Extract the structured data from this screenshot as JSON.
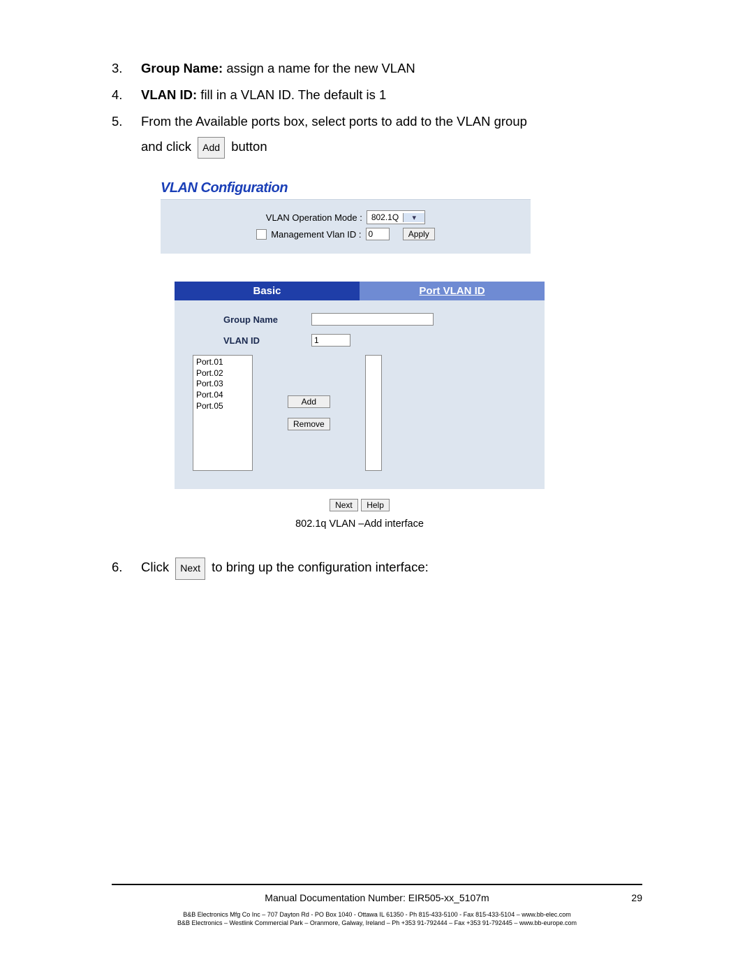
{
  "steps": {
    "s3": {
      "num": "3.",
      "label": "Group Name:",
      "text": " assign a name for the new VLAN"
    },
    "s4": {
      "num": "4.",
      "label": "VLAN ID:",
      "text": " fill in a VLAN ID. The default is 1"
    },
    "s5": {
      "num": "5.",
      "line1": "From the Available ports box, select ports to add to the VLAN group",
      "line2_before": "and click ",
      "btn": "Add",
      "line2_after": " button"
    },
    "s6": {
      "num": "6.",
      "before": "Click ",
      "btn": "Next",
      "after": " to bring up the configuration interface:"
    }
  },
  "vlan_top": {
    "title": "VLAN Configuration",
    "mode_label": "VLAN Operation Mode :",
    "mode_value": "802.1Q",
    "mgmt_label": "Management Vlan ID :",
    "mgmt_value": "0",
    "apply": "Apply"
  },
  "tabs": {
    "basic": "Basic",
    "port": "Port VLAN ID"
  },
  "form": {
    "group_name_label": "Group Name",
    "group_name_value": "",
    "vlan_id_label": "VLAN ID",
    "vlan_id_value": "1",
    "ports": [
      "Port.01",
      "Port.02",
      "Port.03",
      "Port.04",
      "Port.05"
    ],
    "add": "Add",
    "remove": "Remove"
  },
  "bottom": {
    "next": "Next",
    "help": "Help"
  },
  "caption": "802.1q VLAN –Add interface",
  "footer": {
    "doc": "Manual Documentation Number: EIR505-xx_5107m",
    "page": "29",
    "line1": "B&B Electronics Mfg Co Inc – 707 Dayton Rd - PO Box 1040 - Ottawa IL 61350 - Ph 815-433-5100 - Fax 815-433-5104 – www.bb-elec.com",
    "line2": "B&B Electronics – Westlink Commercial Park – Oranmore, Galway, Ireland – Ph +353 91-792444 – Fax +353 91-792445 – www.bb-europe.com"
  }
}
